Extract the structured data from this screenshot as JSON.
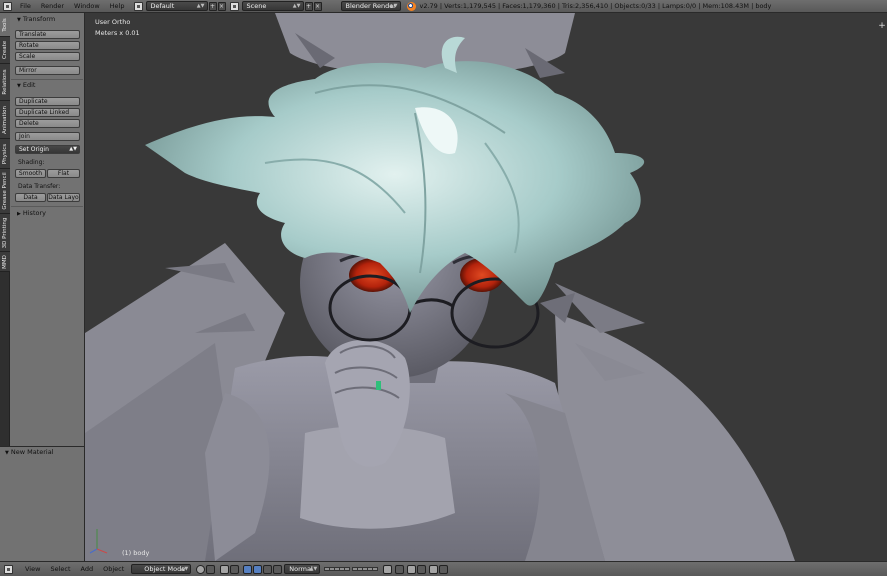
{
  "header": {
    "menus": [
      "File",
      "Render",
      "Window",
      "Help"
    ],
    "layout": "Default",
    "scene": "Scene",
    "engine": "Blender Render",
    "stats": "v2.79 | Verts:1,179,545 | Faces:1,179,360 | Tris:2,356,410 | Objects:0/33 | Lamps:0/0 | Mem:108.43M | body"
  },
  "shelf": {
    "tabs": [
      "Tools",
      "Create",
      "Relations",
      "Animation",
      "Physics",
      "Grease Pencil",
      "3D Printing",
      "MMD"
    ],
    "transform": {
      "title": "Transform",
      "buttons": [
        "Translate",
        "Rotate",
        "Scale",
        "Mirror"
      ]
    },
    "edit": {
      "title": "Edit",
      "buttons": [
        "Duplicate",
        "Duplicate Linked",
        "Delete",
        "Join"
      ],
      "set_origin": "Set Origin",
      "shading_label": "Shading:",
      "smooth": "Smooth",
      "flat": "Flat",
      "data_transfer_label": "Data Transfer:",
      "data": "Data",
      "data_layout": "Data Layo"
    },
    "history": {
      "title": "History"
    }
  },
  "material_panel": {
    "title": "New Material"
  },
  "viewport": {
    "view_name": "User Ortho",
    "units": "Meters x 0.01",
    "object_label": "(1) body"
  },
  "bottom": {
    "menus": [
      "View",
      "Select",
      "Add",
      "Object"
    ],
    "mode": "Object Mode",
    "pivot": "Normal"
  },
  "colors": {
    "header_bg": "#636363",
    "panel_bg": "#727272",
    "viewport_bg": "#393939",
    "hair": "#a9cfcd",
    "eyes": "#c8260e",
    "accent": "#5680c2"
  }
}
